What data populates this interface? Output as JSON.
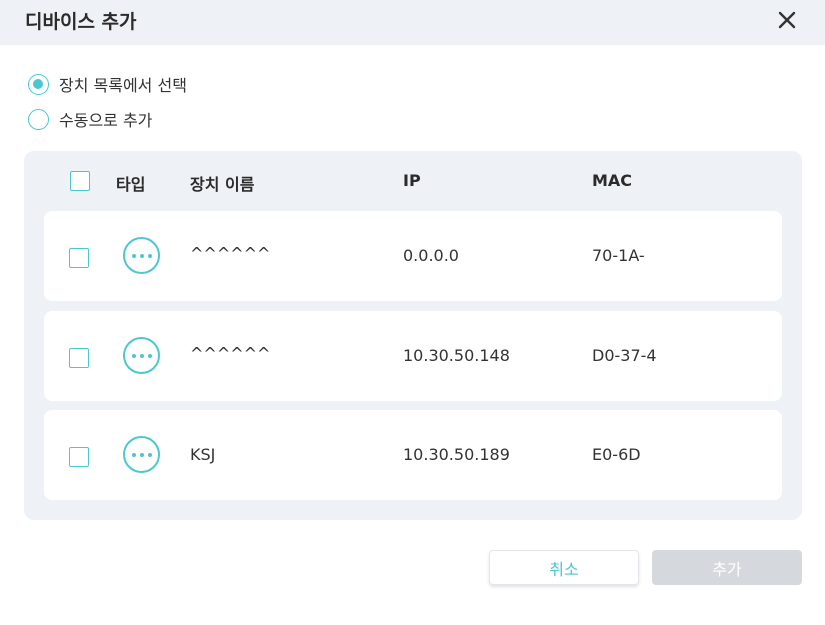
{
  "dialog": {
    "title": "디바이스 추가"
  },
  "mode_options": [
    {
      "label": "장치 목록에서 선택",
      "checked": true
    },
    {
      "label": "수동으로 추가",
      "checked": false
    }
  ],
  "table": {
    "headers": {
      "type": "타입",
      "name": "장치 이름",
      "ip": "IP",
      "mac": "MAC"
    },
    "rows": [
      {
        "name": "^^^^^^",
        "ip": "0.0.0.0",
        "mac": "70-1A-",
        "icon": "more-dots-icon"
      },
      {
        "name": "^^^^^^",
        "ip": "10.30.50.148",
        "mac": "D0-37-4",
        "icon": "more-dots-icon"
      },
      {
        "name": "KSJ",
        "ip": "10.30.50.189",
        "mac": "E0-6D",
        "icon": "more-dots-icon"
      }
    ]
  },
  "buttons": {
    "cancel": "취소",
    "add": "추가"
  },
  "colors": {
    "accent": "#4cc7cf",
    "panel_bg": "#eef1f5",
    "disabled_button": "#d5d8dc"
  }
}
